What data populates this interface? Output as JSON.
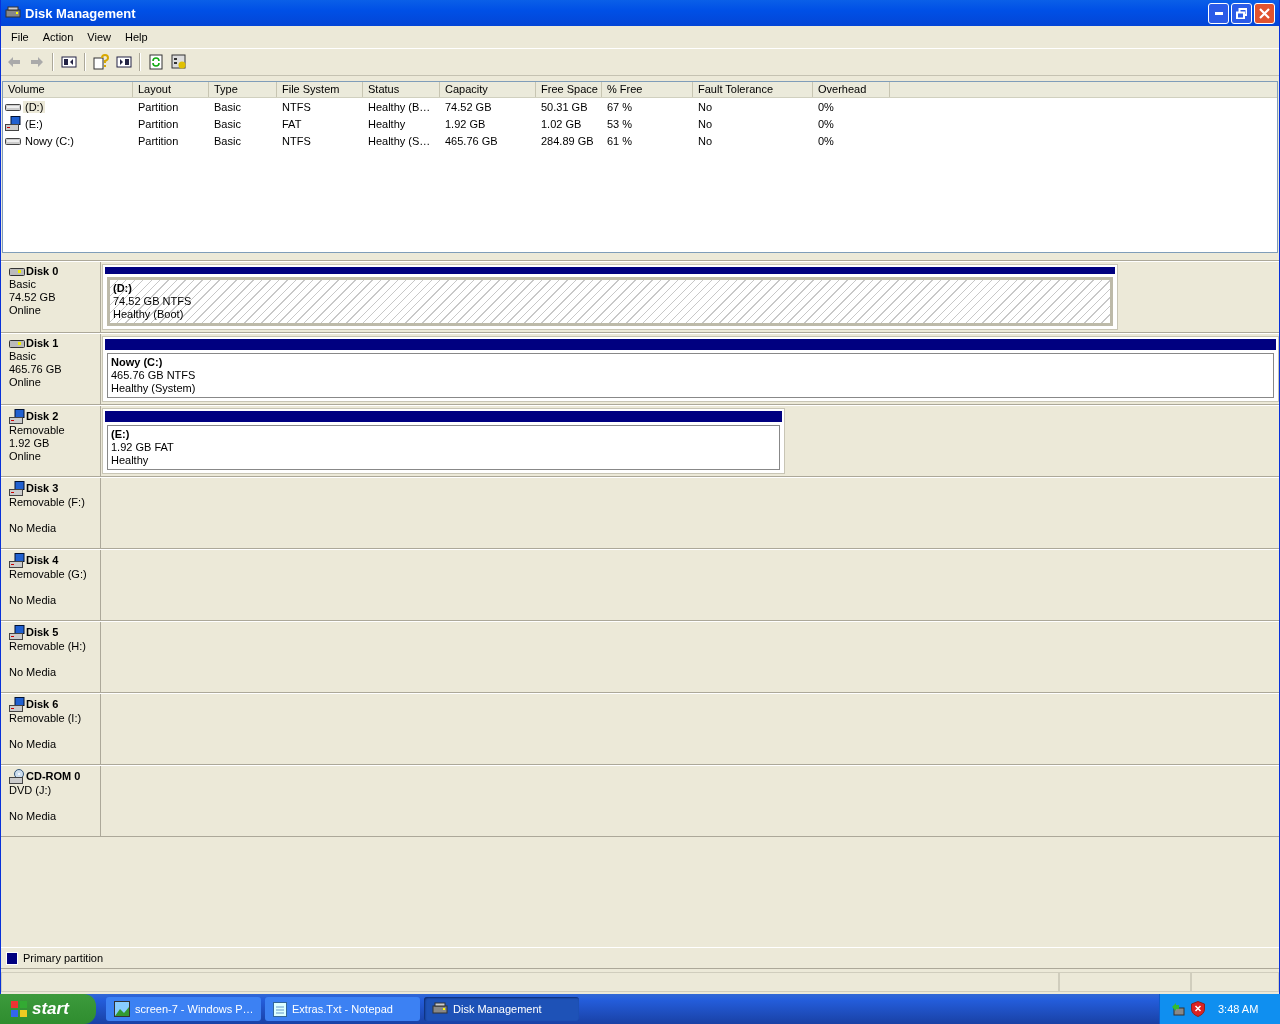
{
  "window": {
    "title": "Disk Management"
  },
  "menu": [
    "File",
    "Action",
    "View",
    "Help"
  ],
  "volume_table": {
    "columns": [
      "Volume",
      "Layout",
      "Type",
      "File System",
      "Status",
      "Capacity",
      "Free Space",
      "% Free",
      "Fault Tolerance",
      "Overhead"
    ],
    "rows": [
      {
        "kind": "hdd",
        "selected": true,
        "cells": [
          "(D:)",
          "Partition",
          "Basic",
          "NTFS",
          "Healthy (B…",
          "74.52 GB",
          "50.31 GB",
          "67 %",
          "No",
          "0%"
        ]
      },
      {
        "kind": "removable",
        "selected": false,
        "cells": [
          "(E:)",
          "Partition",
          "Basic",
          "FAT",
          "Healthy",
          "1.92 GB",
          "1.02 GB",
          "53 %",
          "No",
          "0%"
        ]
      },
      {
        "kind": "hdd",
        "selected": false,
        "cells": [
          "Nowy (C:)",
          "Partition",
          "Basic",
          "NTFS",
          "Healthy (S…",
          "465.76 GB",
          "284.89 GB",
          "61 %",
          "No",
          "0%"
        ]
      }
    ]
  },
  "disks": [
    {
      "kind": "hdd",
      "name": "Disk 0",
      "type": "Basic",
      "size": "74.52 GB",
      "status": "Online",
      "partitions": [
        {
          "name": "(D:)",
          "size": "74.52 GB NTFS",
          "status": "Healthy (Boot)",
          "selected": true
        }
      ]
    },
    {
      "kind": "hdd",
      "name": "Disk 1",
      "type": "Basic",
      "size": "465.76 GB",
      "status": "Online",
      "partitions": [
        {
          "name": "Nowy  (C:)",
          "size": "465.76 GB NTFS",
          "status": "Healthy (System)",
          "selected": false
        }
      ]
    },
    {
      "kind": "removable",
      "name": "Disk 2",
      "type": "Removable",
      "size": "1.92 GB",
      "status": "Online",
      "partitions": [
        {
          "name": "(E:)",
          "size": "1.92 GB FAT",
          "status": "Healthy",
          "selected": false
        }
      ]
    },
    {
      "kind": "removable",
      "name": "Disk 3",
      "type": "Removable (F:)",
      "status": "No Media"
    },
    {
      "kind": "removable",
      "name": "Disk 4",
      "type": "Removable (G:)",
      "status": "No Media"
    },
    {
      "kind": "removable",
      "name": "Disk 5",
      "type": "Removable (H:)",
      "status": "No Media"
    },
    {
      "kind": "removable",
      "name": "Disk 6",
      "type": "Removable (I:)",
      "status": "No Media"
    },
    {
      "kind": "cdrom",
      "name": "CD-ROM 0",
      "type": "DVD (J:)",
      "status": "No Media"
    }
  ],
  "legend": [
    {
      "label": "Primary partition",
      "color": "#000080"
    }
  ],
  "taskbar": {
    "start": "start",
    "items": [
      {
        "kind": "picture",
        "label": "screen-7 - Windows P…",
        "selected": false
      },
      {
        "kind": "notepad",
        "label": "Extras.Txt - Notepad",
        "selected": false
      },
      {
        "kind": "disk",
        "label": "Disk Management",
        "selected": true
      }
    ],
    "clock": "3:48 AM"
  }
}
